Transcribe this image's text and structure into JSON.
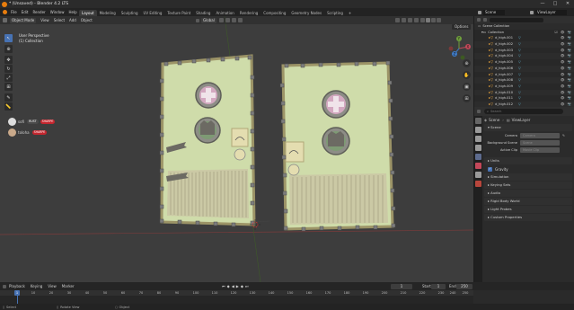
{
  "titlebar": {
    "title": "* (Unsaved) - Blender 4.2 LTS",
    "minimize": "—",
    "maximize": "□",
    "close": "✕"
  },
  "menubar": {
    "menus": [
      "File",
      "Edit",
      "Render",
      "Window",
      "Help"
    ],
    "workspaces": [
      "Layout",
      "Modeling",
      "Sculpting",
      "UV Editing",
      "Texture Paint",
      "Shading",
      "Animation",
      "Rendering",
      "Compositing",
      "Geometry Nodes",
      "Scripting"
    ],
    "active_workspace": "Layout",
    "add_tab": "+",
    "scene_label": "Scene",
    "viewlayer_label": "ViewLayer"
  },
  "viewport": {
    "mode": "Object Mode",
    "menus": [
      "View",
      "Select",
      "Add",
      "Object"
    ],
    "orientation": "Global",
    "options_label": "Options",
    "perspective": "User Perspective",
    "collection": "(1) Collection",
    "overlay_items": [
      {
        "name": "sofi",
        "tag1": "RUST",
        "tag2": "SHARPE"
      },
      {
        "name": "toloha",
        "tag1": "",
        "tag2": "SHARPE"
      }
    ],
    "gizmo": {
      "x": "X",
      "y": "Y",
      "z": "Z"
    }
  },
  "outliner": {
    "header": "Scene Collection",
    "collection": "Collection",
    "items": [
      "d_high.001",
      "d_high.002",
      "d_high.003",
      "d_high.004",
      "d_high.005",
      "d_high.006",
      "d_high.007",
      "d_high.008",
      "d_high.009",
      "d_high.010",
      "d_high.011",
      "d_high.012"
    ]
  },
  "properties": {
    "search_placeholder": "Search",
    "breadcrumb_scene": "Scene",
    "breadcrumb_layer": "ViewLayer",
    "scene_panel": "Scene",
    "fields": [
      {
        "label": "Camera",
        "value": "Camera"
      },
      {
        "label": "Background Scene",
        "value": "Scene"
      },
      {
        "label": "Active Clip",
        "value": "Movie Clip"
      }
    ],
    "units_panel": "Units",
    "gravity_label": "Gravity",
    "panels": [
      "Simulation",
      "Keying Sets",
      "Audio",
      "Rigid Body World",
      "Light Probes",
      "Custom Properties"
    ]
  },
  "timeline": {
    "menus": [
      "Playback",
      "Keying",
      "View",
      "Marker"
    ],
    "current_frame": "1",
    "start_label": "Start",
    "start_value": "1",
    "end_label": "End",
    "end_value": "250",
    "ruler": [
      "1",
      "10",
      "20",
      "30",
      "40",
      "50",
      "60",
      "70",
      "80",
      "90",
      "100",
      "110",
      "120",
      "130",
      "140",
      "150",
      "160",
      "170",
      "180",
      "190",
      "200",
      "210",
      "220",
      "230",
      "240",
      "250"
    ]
  },
  "statusbar": {
    "select": "Select",
    "rotate": "Rotate View",
    "object": "Object"
  }
}
